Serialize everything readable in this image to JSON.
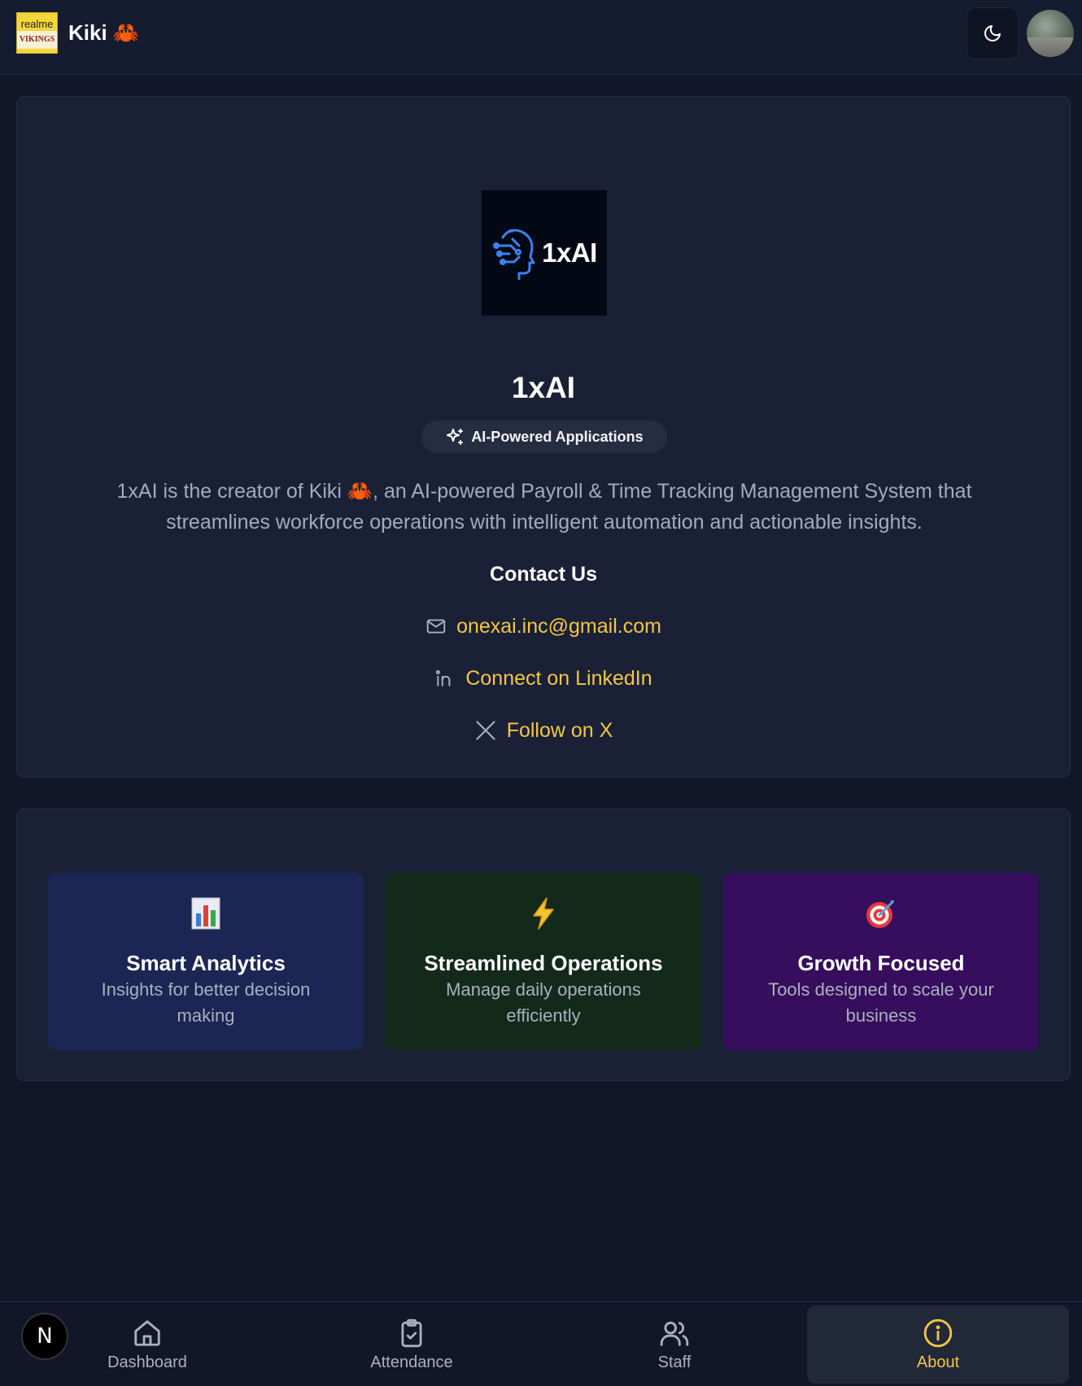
{
  "header": {
    "brand_logo_line1": "realme",
    "brand_logo_line2": "VIKINGS",
    "app_title": "Kiki 🦀"
  },
  "about": {
    "logo_text": "1xAI",
    "company_name": "1xAI",
    "badge_label": "AI-Powered Applications",
    "description": "1xAI is the creator of Kiki 🦀, an AI-powered Payroll & Time Tracking Management System that streamlines workforce operations with intelligent automation and actionable insights.",
    "contact_heading": "Contact Us",
    "contacts": {
      "email": "onexai.inc@gmail.com",
      "linkedin": "Connect on LinkedIn",
      "x": "Follow on X"
    }
  },
  "features": [
    {
      "title": "Smart Analytics",
      "description": "Insights for better decision making",
      "icon": "bar-chart-emoji"
    },
    {
      "title": "Streamlined Operations",
      "description": "Manage daily operations efficiently",
      "icon": "lightning-emoji"
    },
    {
      "title": "Growth Focused",
      "description": "Tools designed to scale your business",
      "icon": "target-emoji"
    }
  ],
  "nav": {
    "dashboard": "Dashboard",
    "attendance": "Attendance",
    "staff": "Staff",
    "about": "About",
    "active": "about"
  },
  "n_badge": "N",
  "colors": {
    "background": "#111729",
    "card": "#1a2136",
    "accent": "#f5c544",
    "logo_blue": "#3b82f6"
  }
}
